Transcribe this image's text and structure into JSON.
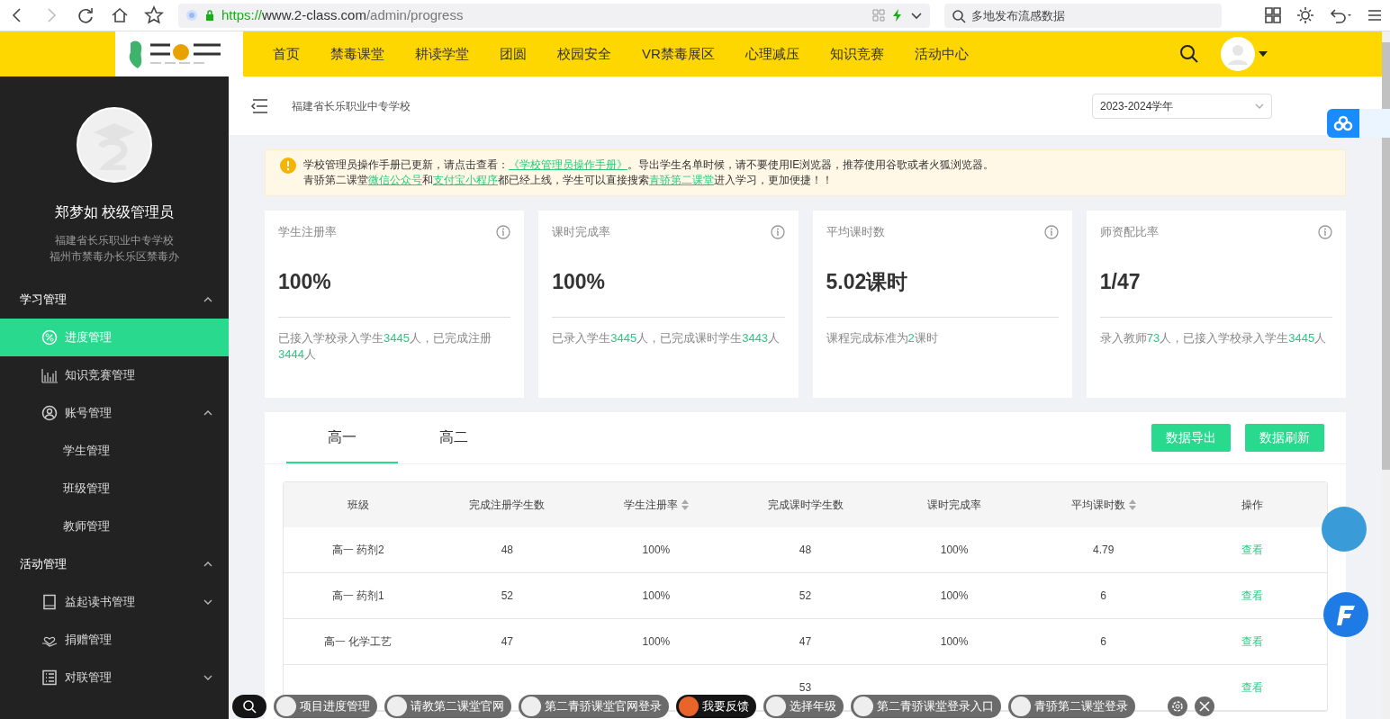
{
  "browser": {
    "url": {
      "scheme": "https://",
      "host": "www.2-class.com",
      "path": "/admin/progress"
    },
    "search": {
      "placeholder": "多地发布流感数据"
    }
  },
  "topnav": {
    "items": [
      {
        "label": "首页"
      },
      {
        "label": "禁毒课堂"
      },
      {
        "label": "耕读学堂"
      },
      {
        "label": "团圆"
      },
      {
        "label": "校园安全"
      },
      {
        "label": "VR禁毒展区"
      },
      {
        "label": "心理减压"
      },
      {
        "label": "知识竞赛"
      },
      {
        "label": "活动中心"
      }
    ]
  },
  "sidebar": {
    "profile": {
      "name": "郑梦如 校级管理员",
      "lines": [
        "福建省长乐职业中专学校",
        "福州市禁毒办长乐区禁毒办"
      ]
    },
    "menu": [
      {
        "label": "学习管理",
        "expanded": true,
        "children": [
          {
            "label": "进度管理",
            "selected": true
          },
          {
            "label": "知识竞赛管理",
            "selected": false
          },
          {
            "label": "账号管理",
            "selected": false,
            "expanded": true,
            "children": [
              {
                "label": "学生管理",
                "selected": false
              },
              {
                "label": "班级管理",
                "selected": false
              },
              {
                "label": "教师管理",
                "selected": false
              }
            ]
          }
        ]
      },
      {
        "label": "活动管理",
        "expanded": true,
        "children": [
          {
            "label": "益起读书管理",
            "selected": false,
            "expanded": false
          },
          {
            "label": "捐赠管理",
            "selected": false
          },
          {
            "label": "对联管理",
            "selected": false,
            "expanded": false
          }
        ]
      }
    ]
  },
  "header": {
    "school": "福建省长乐职业中专学校",
    "year_select": {
      "value": "2023-2024学年"
    }
  },
  "notice": {
    "lines": [
      [
        {
          "text": "学校管理员操作手册已更新，请点击查看：",
          "link": false
        },
        {
          "text": "《学校管理员操作手册》",
          "link": true
        },
        {
          "text": "。导出学生名单时候，请不要使用IE浏览器，推荐使用谷歌或者火狐浏览器。",
          "link": false
        }
      ],
      [
        {
          "text": "青骄第二课堂",
          "link": false
        },
        {
          "text": "微信公众号",
          "link": true
        },
        {
          "text": "和",
          "link": false
        },
        {
          "text": "支付宝小程序",
          "link": true
        },
        {
          "text": "都已经上线，学生可以直接搜索",
          "link": false
        },
        {
          "text": "青骄第二课堂",
          "link": true
        },
        {
          "text": "进入学习，更加便捷！！",
          "link": false
        }
      ]
    ]
  },
  "stats": [
    {
      "title": "学生注册率",
      "value": "100%",
      "desc": [
        {
          "text": "已接入学校录入学生",
          "highlight": false
        },
        {
          "text": "3445",
          "highlight": true
        },
        {
          "text": "人，已完成注册",
          "highlight": false
        },
        {
          "text": "3444",
          "highlight": true
        },
        {
          "text": "人",
          "highlight": false
        }
      ]
    },
    {
      "title": "课时完成率",
      "value": "100%",
      "desc": [
        {
          "text": "已录入学生",
          "highlight": false
        },
        {
          "text": "3445",
          "highlight": true
        },
        {
          "text": "人，已完成课时学生",
          "highlight": false
        },
        {
          "text": "3443",
          "highlight": true
        },
        {
          "text": "人",
          "highlight": false
        }
      ]
    },
    {
      "title": "平均课时数",
      "value": "5.02课时",
      "desc": [
        {
          "text": "课程完成标准为",
          "highlight": false
        },
        {
          "text": "2",
          "highlight": true
        },
        {
          "text": "课时",
          "highlight": false
        }
      ]
    },
    {
      "title": "师资配比率",
      "value": "1/47",
      "desc": [
        {
          "text": "录入教师",
          "highlight": false
        },
        {
          "text": "73",
          "highlight": true
        },
        {
          "text": "人，已接入学校录入学生",
          "highlight": false
        },
        {
          "text": "3445",
          "highlight": true
        },
        {
          "text": "人",
          "highlight": false
        }
      ]
    }
  ],
  "grade_tabs": [
    {
      "label": "高一",
      "selected": true
    },
    {
      "label": "高二",
      "selected": false
    }
  ],
  "actions": [
    "数据导出",
    "数据刷新"
  ],
  "table": {
    "columns": [
      {
        "label": "班级",
        "sortable": false
      },
      {
        "label": "完成注册学生数",
        "sortable": false
      },
      {
        "label": "学生注册率",
        "sortable": true
      },
      {
        "label": "完成课时学生数",
        "sortable": false
      },
      {
        "label": "课时完成率",
        "sortable": false
      },
      {
        "label": "平均课时数",
        "sortable": true
      },
      {
        "label": "操作",
        "sortable": false
      }
    ],
    "rows": [
      {
        "cells": [
          "高一 药剂2",
          "48",
          "100%",
          "48",
          "100%",
          "4.79"
        ],
        "action": "查看"
      },
      {
        "cells": [
          "高一 药剂1",
          "52",
          "100%",
          "52",
          "100%",
          "6"
        ],
        "action": "查看"
      },
      {
        "cells": [
          "高一 化学工艺",
          "47",
          "100%",
          "47",
          "100%",
          "6"
        ],
        "action": "查看"
      },
      {
        "cells": [
          null,
          null,
          null,
          "53",
          null,
          null
        ],
        "action": "查看"
      }
    ]
  },
  "float_bar": {
    "chips": [
      {
        "label": "项目进度管理",
        "selected": false
      },
      {
        "label": "请教第二课堂官网",
        "selected": false
      },
      {
        "label": "第二青骄课堂官网登录",
        "selected": false
      },
      {
        "label": "我要反馈",
        "selected": true
      },
      {
        "label": "选择年级",
        "selected": false
      },
      {
        "label": "第二青骄课堂登录入口",
        "selected": false
      },
      {
        "label": "青骄第二课堂登录",
        "selected": false
      }
    ]
  }
}
